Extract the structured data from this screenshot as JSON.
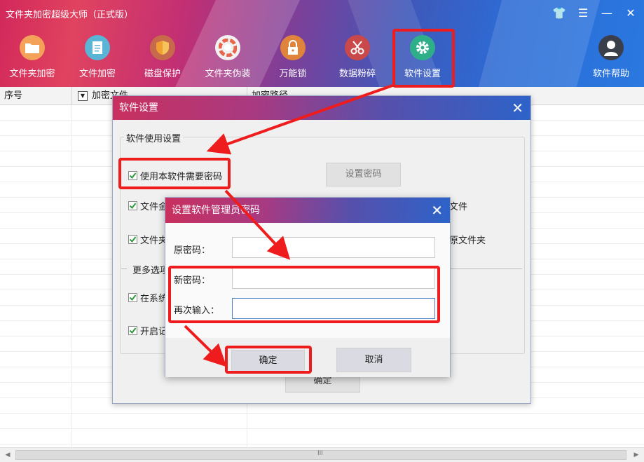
{
  "app": {
    "title": "文件夹加密超级大师（正式版）"
  },
  "window_controls": {
    "skin": "👕",
    "menu": "☰",
    "minimize": "—",
    "close": "✕"
  },
  "toolbar": {
    "items": [
      {
        "label": "文件夹加密",
        "icon": "folder-icon"
      },
      {
        "label": "文件加密",
        "icon": "file-icon"
      },
      {
        "label": "磁盘保护",
        "icon": "shield-icon"
      },
      {
        "label": "文件夹伪装",
        "icon": "disguise-icon"
      },
      {
        "label": "万能锁",
        "icon": "lock-icon"
      },
      {
        "label": "数据粉碎",
        "icon": "shredder-icon"
      },
      {
        "label": "软件设置",
        "icon": "gear-icon"
      }
    ],
    "help_label": "软件帮助"
  },
  "table": {
    "columns": [
      "序号",
      "加密文件",
      "加密路径"
    ]
  },
  "settings_dialog": {
    "title": "软件设置",
    "group_label": "软件使用设置",
    "require_password_label": "使用本软件需要密码",
    "set_password_button": "设置密码",
    "option2_left": "文件金",
    "option2_right": "文件",
    "option3_left": "文件夹",
    "option3_right": "原文件夹",
    "more_options_label": "更多选项",
    "option4_left": "在系统",
    "option5_left": "开启记",
    "ok_button": "确定"
  },
  "password_dialog": {
    "title": "设置软件管理员密码",
    "old_password_label": "原密码：",
    "new_password_label": "新密码：",
    "repeat_label": "再次输入：",
    "ok_button": "确定",
    "cancel_button": "取消"
  },
  "scrollbar": {
    "grip": "III"
  },
  "colors": {
    "annotation_red": "#ee1c1c",
    "checkbox_green": "#2d9a3e"
  }
}
